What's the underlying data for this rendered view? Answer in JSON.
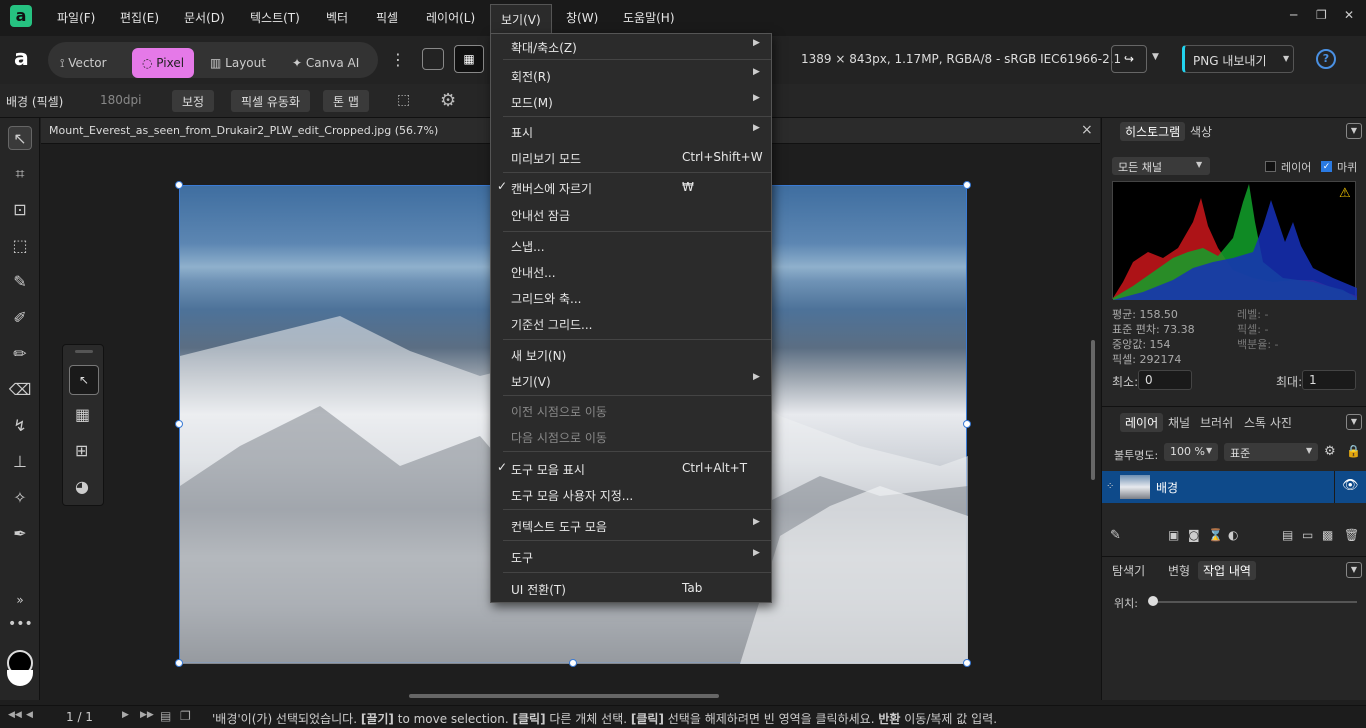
{
  "menubar": {
    "logo": "a",
    "items": [
      "파일(F)",
      "편집(E)",
      "문서(D)",
      "텍스트(T)",
      "벡터",
      "픽셀",
      "레이어(L)",
      "보기(V)",
      "창(W)",
      "도움말(H)"
    ]
  },
  "toolbar": {
    "personas": [
      "Vector",
      "Pixel",
      "Layout",
      "Canva AI"
    ],
    "doc_info": "1389 × 843px, 1.17MP, RGBA/8 - sRGB IEC61966-2.1",
    "export_label": "PNG 내보내기"
  },
  "context": {
    "layer_name": "배경 (픽셀)",
    "dpi": "180dpi",
    "buttons": [
      "보정",
      "픽셀 유동화",
      "톤 맵"
    ]
  },
  "document": {
    "tab_title": "Mount_Everest_as_seen_from_Drukair2_PLW_edit_Cropped.jpg (56.7%)",
    "close": "×"
  },
  "view_menu": {
    "items": [
      {
        "label": "확대/축소(Z)",
        "shortcut": "",
        "arrow": true,
        "check": false,
        "disabled": false
      },
      {
        "label": "회전(R)",
        "shortcut": "",
        "arrow": true,
        "check": false,
        "disabled": false
      },
      {
        "label": "모드(M)",
        "shortcut": "",
        "arrow": true,
        "check": false,
        "disabled": false
      },
      {
        "label": "표시",
        "shortcut": "",
        "arrow": true,
        "check": false,
        "disabled": false
      },
      {
        "label": "미리보기 모드",
        "shortcut": "Ctrl+Shift+W",
        "arrow": false,
        "check": false,
        "disabled": false
      },
      {
        "label": "캔버스에 자르기",
        "shortcut": "₩",
        "arrow": false,
        "check": true,
        "disabled": false
      },
      {
        "label": "안내선 잠금",
        "shortcut": "",
        "arrow": false,
        "check": false,
        "disabled": false
      },
      {
        "label": "스냅...",
        "shortcut": "",
        "arrow": false,
        "check": false,
        "disabled": false
      },
      {
        "label": "안내선...",
        "shortcut": "",
        "arrow": false,
        "check": false,
        "disabled": false
      },
      {
        "label": "그리드와 축...",
        "shortcut": "",
        "arrow": false,
        "check": false,
        "disabled": false
      },
      {
        "label": "기준선 그리드...",
        "shortcut": "",
        "arrow": false,
        "check": false,
        "disabled": false
      },
      {
        "label": "새 보기(N)",
        "shortcut": "",
        "arrow": false,
        "check": false,
        "disabled": false
      },
      {
        "label": "보기(V)",
        "shortcut": "",
        "arrow": true,
        "check": false,
        "disabled": false
      },
      {
        "label": "이전 시점으로 이동",
        "shortcut": "",
        "arrow": false,
        "check": false,
        "disabled": true
      },
      {
        "label": "다음 시점으로 이동",
        "shortcut": "",
        "arrow": false,
        "check": false,
        "disabled": true
      },
      {
        "label": "도구 모음 표시",
        "shortcut": "Ctrl+Alt+T",
        "arrow": false,
        "check": true,
        "disabled": false
      },
      {
        "label": "도구 모음 사용자 지정...",
        "shortcut": "",
        "arrow": false,
        "check": false,
        "disabled": false
      },
      {
        "label": "컨텍스트 도구 모음",
        "shortcut": "",
        "arrow": true,
        "check": false,
        "disabled": false
      },
      {
        "label": "도구",
        "shortcut": "",
        "arrow": true,
        "check": false,
        "disabled": false
      },
      {
        "label": "UI 전환(T)",
        "shortcut": "Tab",
        "arrow": false,
        "check": false,
        "disabled": false
      }
    ]
  },
  "histogram": {
    "tabs": [
      "히스토그램",
      "색상"
    ],
    "channel": "모든 채널",
    "layer_label": "레이어",
    "marquee_label": "마퀴",
    "stats_left": [
      "평균: 158.50",
      "표준 편차: 73.38",
      "중앙값: 154",
      "픽셀: 292174"
    ],
    "stats_right": [
      "레벨: -",
      "픽셀: -",
      "백분율: -"
    ],
    "min_label": "최소:",
    "min_value": "0",
    "max_label": "최대:",
    "max_value": "1"
  },
  "layers": {
    "tabs": [
      "레이어",
      "채널",
      "브러쉬",
      "스톡 사진"
    ],
    "opacity_label": "불투명도:",
    "opacity_value": "100 %",
    "blend_mode": "표준",
    "layer_name": "배경"
  },
  "history": {
    "tabs": [
      "탐색기",
      "변형",
      "작업 내역"
    ],
    "position_label": "위치:"
  },
  "statusbar": {
    "page": "1 / 1",
    "message_parts": [
      "'배경'이(가) 선택되었습니다. ",
      "[끌기]",
      " to move selection. ",
      "[클릭]",
      " 다른 개체 선택. ",
      "[클릭]",
      " 선택을 해제하려면 빈 영역을 클릭하세요. ",
      "반환",
      " 이동/복제 값 입력."
    ]
  },
  "colors": {
    "accent": "#e579e8",
    "selection": "#0e4a8a",
    "brand": "#26c281"
  }
}
